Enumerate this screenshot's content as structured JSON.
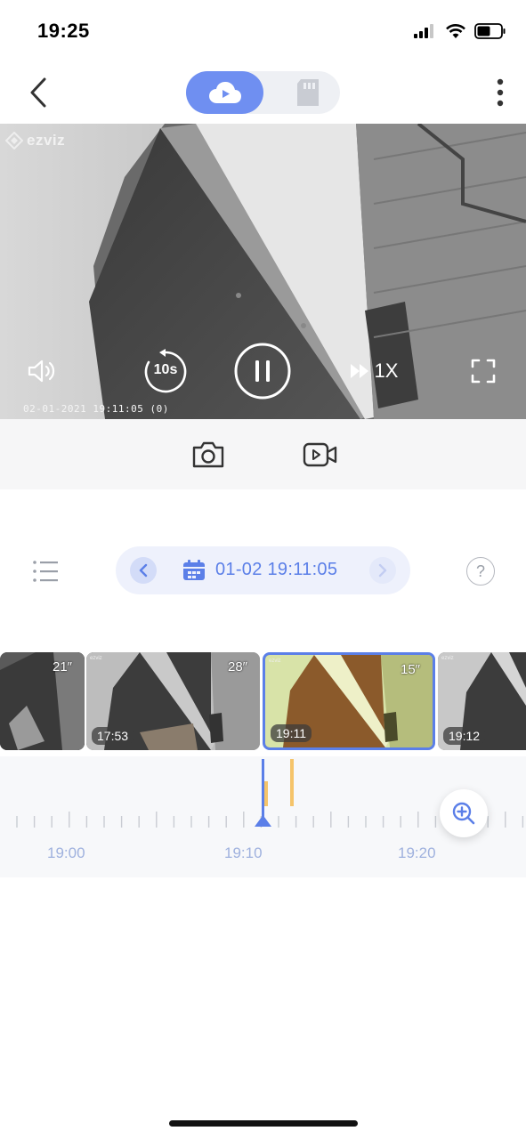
{
  "status_bar": {
    "time": "19:25"
  },
  "top_bar": {
    "back_icon": "chevron-left-icon",
    "toggle": {
      "cloud_icon": "cloud-play-icon",
      "sd_icon": "sd-card-icon",
      "selected": "cloud"
    },
    "more_icon": "more-vertical-icon"
  },
  "video": {
    "brand": "ezviz",
    "osd_timestamp": "02-01-2021 19:11:05 (0)",
    "controls": {
      "volume_icon": "volume-icon",
      "rewind_label": "10s",
      "pause_icon": "pause-icon",
      "speed_label": "1X",
      "fullscreen_icon": "fullscreen-icon"
    }
  },
  "tools": {
    "snapshot_icon": "camera-icon",
    "record_icon": "video-record-icon"
  },
  "date_nav": {
    "list_icon": "list-icon",
    "date_label": "01-02 19:11:05",
    "calendar_icon": "calendar-icon",
    "help_label": "?"
  },
  "thumbnails": [
    {
      "duration": "21″",
      "time": ""
    },
    {
      "duration": "28″",
      "time": "17:53"
    },
    {
      "duration": "15″",
      "time": "19:11",
      "selected": true
    },
    {
      "duration": "",
      "time": "19:12"
    }
  ],
  "timeline": {
    "labels": [
      "19:00",
      "19:10",
      "19:20"
    ],
    "zoom_icon": "zoom-in-icon"
  },
  "colors": {
    "accent": "#5b7fe8",
    "event_marker": "#f5c46a"
  }
}
